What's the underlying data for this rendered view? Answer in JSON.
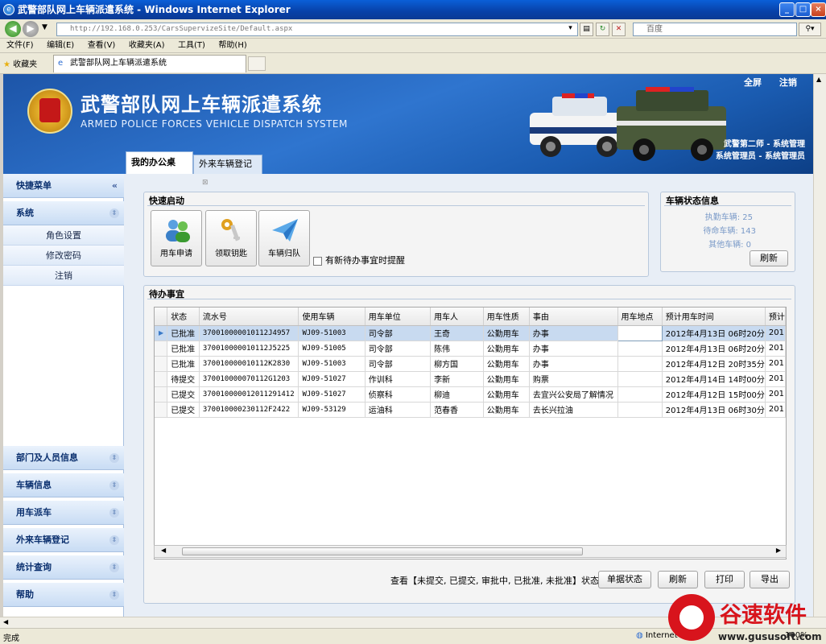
{
  "browser": {
    "title": "武警部队网上车辆派遣系统 - Windows Internet Explorer",
    "address": "http://192.168.0.253/CarsSupervizeSite/Default.aspx",
    "search_placeholder": "百度",
    "menu": [
      "文件(F)",
      "编辑(E)",
      "查看(V)",
      "收藏夹(A)",
      "工具(T)",
      "帮助(H)"
    ],
    "favorites_label": "收藏夹",
    "tab_title": "武警部队网上车辆派遣系统",
    "status_text": "完成",
    "zone_text": "Internet",
    "zoom_text": "100%"
  },
  "header": {
    "title_cn": "武警部队网上车辆派遣系统",
    "title_en": "ARMED POLICE FORCES VEHICLE DISPATCH SYSTEM",
    "fullscreen": "全屏",
    "logout": "注销",
    "user_line1": "武警第二师 - 系统管理",
    "user_line2": "系统管理员 - 系统管理员"
  },
  "page_tabs": [
    "我的办公桌",
    "外来车辆登记"
  ],
  "sidebar": {
    "quick_menu": "快捷菜单",
    "system": "系统",
    "items": [
      "角色设置",
      "修改密码",
      "注销"
    ],
    "bottom_sections": [
      "部门及人员信息",
      "车辆信息",
      "用车派车",
      "外来车辆登记",
      "统计查询",
      "帮助"
    ]
  },
  "quick_start": {
    "title": "快速启动",
    "buttons": [
      "用车申请",
      "领取钥匙",
      "车辆归队"
    ],
    "remind_label": "有新待办事宜时提醒"
  },
  "vehicle_status": {
    "title": "车辆状态信息",
    "on_duty": "执勤车辆: 25",
    "standby": "待命车辆: 143",
    "other": "其他车辆: 0",
    "refresh": "刷新"
  },
  "todo": {
    "title": "待办事宜",
    "columns": [
      "状态",
      "流水号",
      "使用车辆",
      "用车单位",
      "用车人",
      "用车性质",
      "事由",
      "用车地点",
      "预计用车时间",
      "预计"
    ],
    "rows": [
      [
        "已批准",
        "370010000010112J4957",
        "WJ09-51003",
        "司令部",
        "王奇",
        "公勤用车",
        "办事",
        "",
        "2012年4月13日 06时20分",
        "201"
      ],
      [
        "已批准",
        "370010000010112J5225",
        "WJ09-51005",
        "司令部",
        "陈伟",
        "公勤用车",
        "办事",
        "",
        "2012年4月13日 06时20分",
        "201"
      ],
      [
        "已批准",
        "370010000010112K2830",
        "WJ09-51003",
        "司令部",
        "柳方国",
        "公勤用车",
        "办事",
        "",
        "2012年4月12日 20时35分",
        "201"
      ],
      [
        "待提交",
        "370010000070112G1203",
        "WJ09-51027",
        "作训科",
        "李新",
        "公勤用车",
        "购票",
        "",
        "2012年4月14日 14时00分",
        "201"
      ],
      [
        "已提交",
        "370010000012011291412",
        "WJ09-51027",
        "侦察科",
        "柳迪",
        "公勤用车",
        "去宜兴公安局了解情况",
        "",
        "2012年4月12日 15时00分",
        "201"
      ],
      [
        "已提交",
        "370010000230112F2422",
        "WJ09-53129",
        "运油科",
        "范春香",
        "公勤用车",
        "去长兴拉油",
        "",
        "2012年4月13日 06时30分",
        "201"
      ]
    ],
    "view_text": "查看【未提交, 已提交, 审批中, 已批准, 未批准】状态单据",
    "buttons": [
      "单据状态",
      "刷新",
      "打印",
      "导出"
    ]
  },
  "watermark": {
    "cn": "谷速软件",
    "url": "www.gususoft.com"
  },
  "colors": {
    "header_blue": "#2f75cf",
    "selected_row": "#c8daf0",
    "watermark_red": "#d8141c"
  }
}
